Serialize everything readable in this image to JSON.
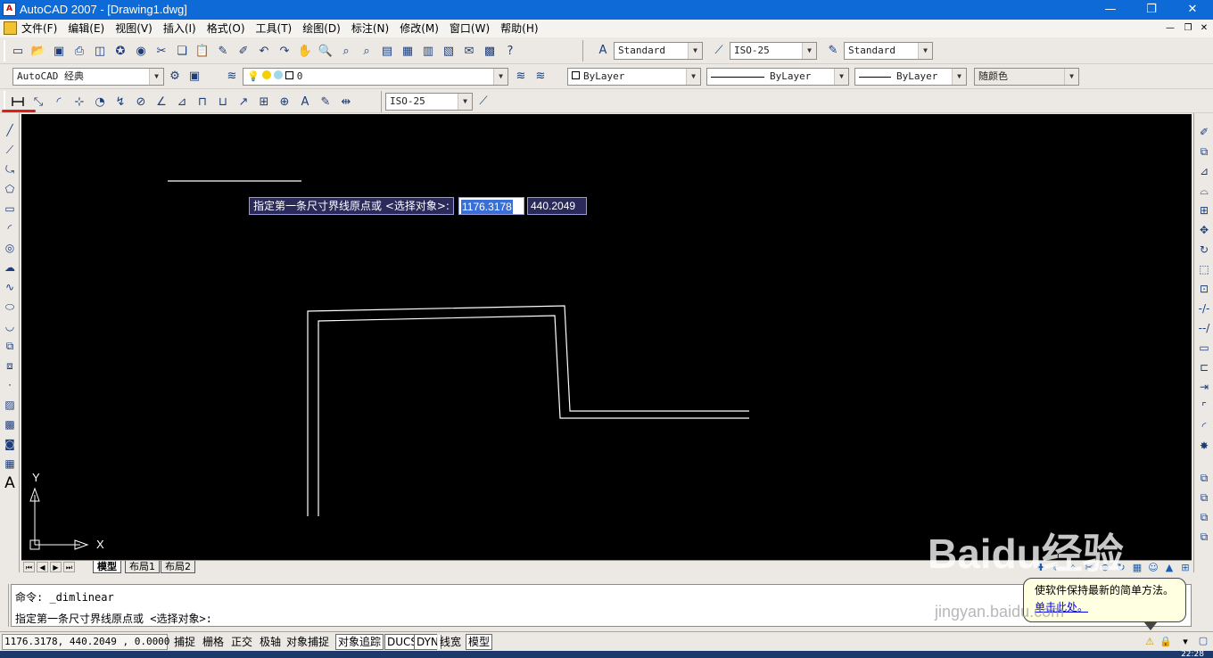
{
  "window": {
    "title": "AutoCAD 2007 - [Drawing1.dwg]",
    "app_icon_label": "A",
    "minimize": "—",
    "maximize": "❐",
    "close": "✕"
  },
  "menu": {
    "items": [
      "文件(F)",
      "编辑(E)",
      "视图(V)",
      "插入(I)",
      "格式(O)",
      "工具(T)",
      "绘图(D)",
      "标注(N)",
      "修改(M)",
      "窗口(W)",
      "帮助(H)"
    ],
    "doc_controls": [
      "—",
      "❐",
      "✕"
    ]
  },
  "toolbars": {
    "text_style": "Standard",
    "dim_style": "ISO-25",
    "table_style": "Standard",
    "workspace": "AutoCAD 经典",
    "layer": "0",
    "color": "ByLayer",
    "linetype": "ByLayer",
    "lineweight": "ByLayer",
    "plot_style": "随颜色",
    "dim_toolbar_style": "ISO-25"
  },
  "canvas": {
    "prompt": "指定第一条尺寸界线原点或 <选择对象>:",
    "input_x": "1176.3178",
    "input_y": "440.2049",
    "axis_x": "X",
    "axis_y": "Y"
  },
  "tabs": {
    "items": [
      "模型",
      "布局1",
      "布局2"
    ],
    "active": "模型"
  },
  "command": {
    "line1": "命令: _dimlinear",
    "line2": "指定第一条尺寸界线原点或 <选择对象>:"
  },
  "status": {
    "coords": "1176.3178, 440.2049 , 0.0000",
    "buttons": [
      "捕捉",
      "栅格",
      "正交",
      "极轴",
      "对象捕捉",
      "对象追踪",
      "DUCS",
      "DYN",
      "线宽",
      "模型"
    ],
    "on_buttons": [
      "对象追踪",
      "DUCS",
      "DYN",
      "模型"
    ]
  },
  "balloon": {
    "message": "使软件保持最新的简单方法。",
    "link": "单击此处。"
  },
  "taskbar": {
    "clock": "22:28"
  },
  "watermark": {
    "main": "Baidu经验",
    "sub": "jingyan.baidu.com"
  }
}
